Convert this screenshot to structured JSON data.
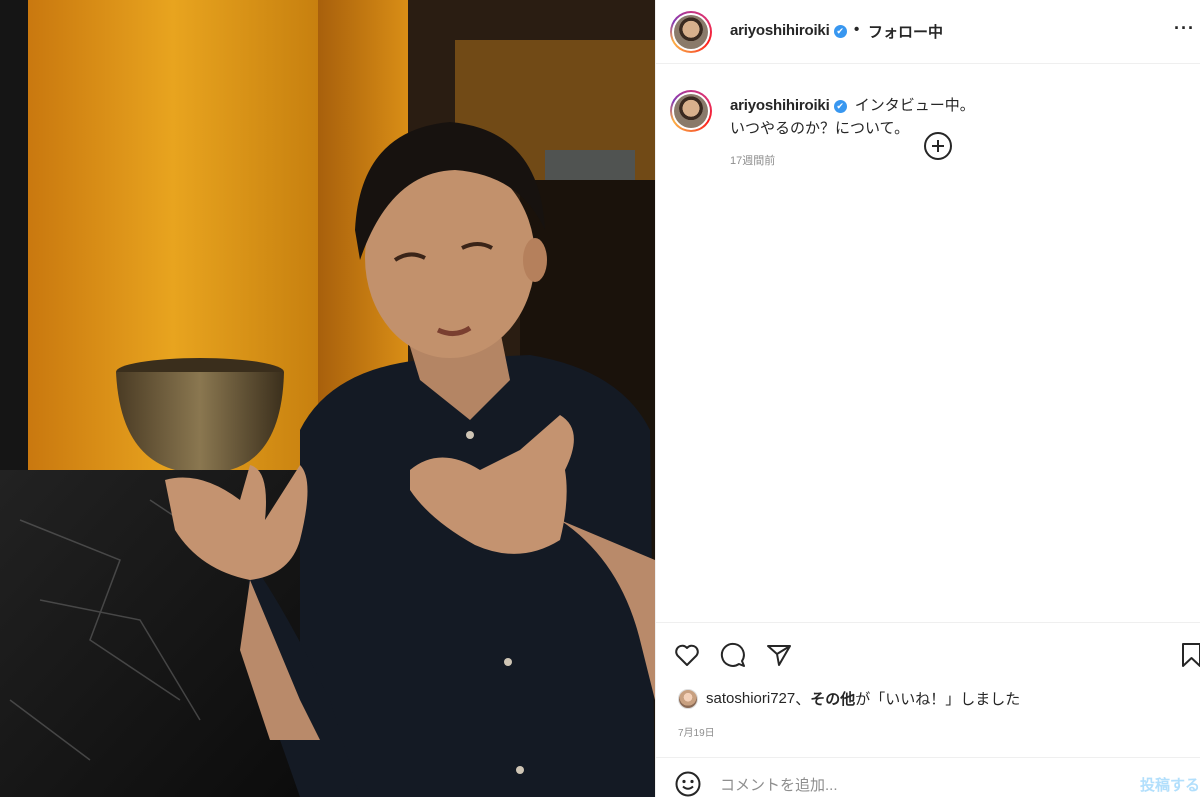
{
  "post": {
    "image_alt": "man in dark shirt gesturing in front of warm wood-paneled wall with a ceramic bowl",
    "account": {
      "username": "ariyoshihiroiki",
      "verified_mark": "✔",
      "separator": "•",
      "follow_status": "フォロー中",
      "more_label": "···"
    },
    "caption": {
      "username": "ariyoshihiroiki",
      "line1": "インタビュー中。",
      "line2": "いつやるのか？について。",
      "time_ago": "17週間前"
    },
    "actions": {
      "like_icon": "heart-icon",
      "comment_icon": "comment-icon",
      "share_icon": "share-icon",
      "save_icon": "bookmark-icon"
    },
    "likes": {
      "user": "satoshiori727",
      "connector": "、",
      "others": "その他",
      "suffix": "が「いいね！」しました"
    },
    "date": "7月19日",
    "comment": {
      "placeholder": "コメントを追加...",
      "post_label": "投稿する"
    }
  },
  "colors": {
    "link_blue": "#3897f0",
    "post_disabled": "#b2dffc",
    "muted_text": "#8e8e8e",
    "border": "#efefef"
  }
}
